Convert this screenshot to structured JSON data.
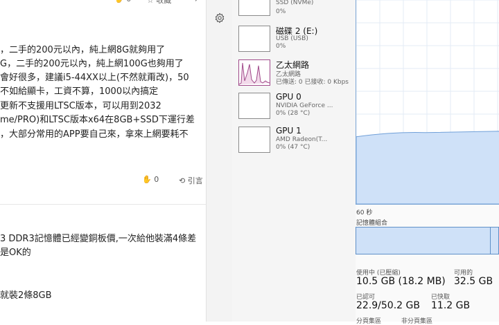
{
  "forum": {
    "top_actions": {
      "like_count": "0",
      "favorite_label": "收藏"
    },
    "post_lines": [
      "，二手的200元以內，純上網8G就夠用了",
      "G，二手的200元以內，純上網100G也夠用了",
      "會好很多，建議i5-44XX以上(不然就甭改)，50",
      "不如給顯卡，工資不算，1000以內搞定",
      "更新不支援用LTSC版本，可以用到2032",
      "me/PRO)和LTSC版本x64在8GB+SSD下運行差",
      "，大部分常用的APP要自己來，拿來上網要耗不"
    ],
    "post_actions": {
      "like_count": "0",
      "quote_label": "引言"
    },
    "reply_lines": [
      "3 DDR3記憶體已經變銅板價,一次給他裝滿4條差",
      "是OK的",
      "",
      "就裝2條8GB"
    ]
  },
  "taskmgr": {
    "devices": [
      {
        "name": "",
        "lines": [
          "SSD (NVMe)",
          "0%"
        ]
      },
      {
        "name": "磁碟 2 (E:)",
        "lines": [
          "USB (USB)",
          "0%"
        ]
      },
      {
        "name": "乙太網路",
        "lines": [
          "乙太網路",
          "已傳送: 0 已接收: 0 Kbps"
        ]
      },
      {
        "name": "GPU 0",
        "lines": [
          "NVIDIA GeForce ...",
          "0% (28 °C)"
        ]
      },
      {
        "name": "GPU 1",
        "lines": [
          "AMD Radeon(T...",
          "0% (47 °C)"
        ]
      }
    ],
    "graph_time_label": "60 秒",
    "memory_composition_label": "記憶體組合",
    "usage_fill_fraction": 0.35,
    "stats": {
      "in_use_label": "使用中 (已壓縮)",
      "in_use_value": "10.5 GB (18.2 MB)",
      "available_label": "可用的",
      "available_value": "32.5 GB",
      "committed_label": "已認可",
      "committed_value": "22.9/50.2 GB",
      "cached_label": "已快取",
      "cached_value": "11.2 GB",
      "paged_pool_label": "分頁集區",
      "nonpaged_pool_label": "非分頁集區"
    },
    "colors": {
      "graph_line": "#6f9fd8",
      "graph_fill": "#cfe1f8",
      "grid": "#e3ebf5"
    }
  }
}
